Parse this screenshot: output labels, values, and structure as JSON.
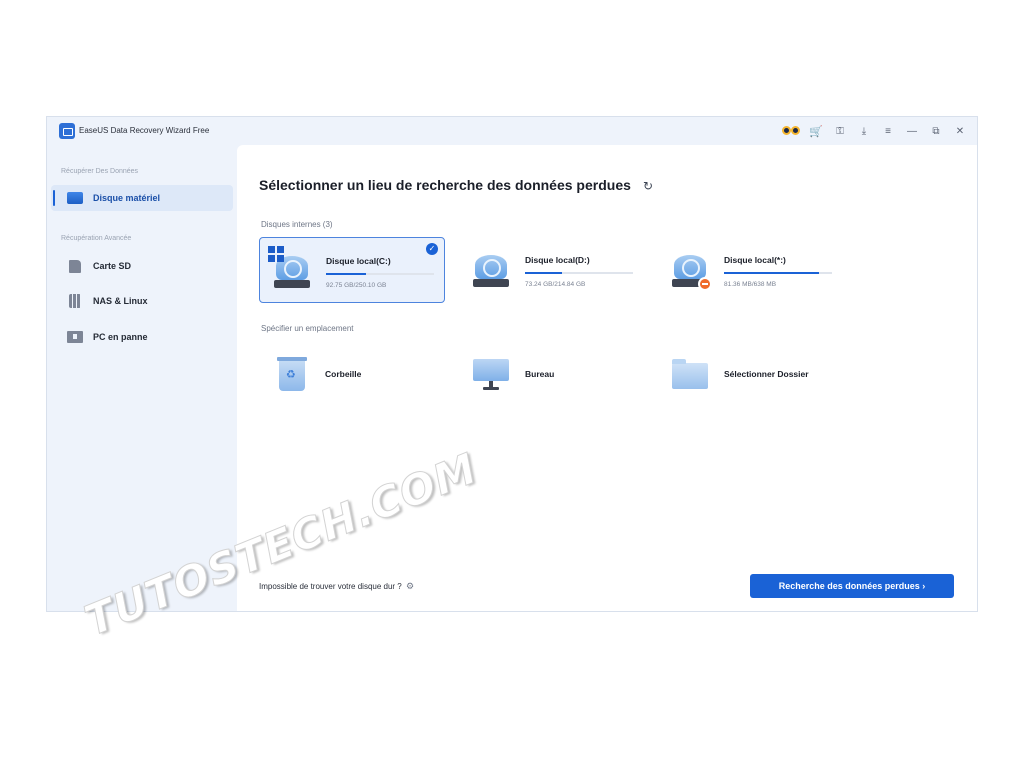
{
  "app": {
    "title": "EaseUS Data Recovery Wizard Free"
  },
  "titlebar": {
    "icons": [
      "owl-icon",
      "cart-icon",
      "key-icon",
      "download-icon",
      "menu-icon",
      "minimize-icon",
      "restore-icon",
      "close-icon"
    ],
    "menu_glyph": "≡",
    "minimize_glyph": "—",
    "restore_glyph": "⧉",
    "close_glyph": "✕",
    "key_glyph": "⚿",
    "download_glyph": "⤓",
    "cart_glyph": "🛒"
  },
  "sidebar": {
    "section1": "Récupérer Des Données",
    "section2": "Récupération Avancée",
    "items": [
      {
        "label": "Disque matériel",
        "active": true,
        "icon": "disk-icon"
      },
      {
        "label": "Carte SD",
        "active": false,
        "icon": "sd-card-icon"
      },
      {
        "label": "NAS & Linux",
        "active": false,
        "icon": "nas-icon"
      },
      {
        "label": "PC en panne",
        "active": false,
        "icon": "pc-icon"
      }
    ]
  },
  "main": {
    "title": "Sélectionner un lieu de recherche des données perdues",
    "refresh_glyph": "↻",
    "internal_label": "Disques internes (3)",
    "drives": [
      {
        "name": "Disque local(C:)",
        "size": "92.75 GB/250.10 GB",
        "used_fraction": 0.37,
        "selected": true,
        "badge": "windows"
      },
      {
        "name": "Disque local(D:)",
        "size": "73.24 GB/214.84 GB",
        "used_fraction": 0.34,
        "selected": false,
        "badge": ""
      },
      {
        "name": "Disque local(*:)",
        "size": "81.36 MB/638 MB",
        "used_fraction": 0.88,
        "selected": false,
        "badge": "warning"
      }
    ],
    "location_label": "Spécifier un emplacement",
    "locations": [
      {
        "name": "Corbeille",
        "icon": "recycle-bin-icon"
      },
      {
        "name": "Bureau",
        "icon": "desktop-icon"
      },
      {
        "name": "Sélectionner Dossier",
        "icon": "folder-icon"
      }
    ],
    "footer_text": "Impossible de trouver votre disque dur ?",
    "gear_glyph": "⚙",
    "check_glyph": "✓",
    "scan_button": "Recherche des données perdues ›"
  },
  "watermark": "TUTOSTECH.COM",
  "colors": {
    "accent": "#1a62d6",
    "sidebar_bg": "#eef3fb",
    "warning": "#f06a2a",
    "owl": "#f5b52e",
    "cart": "#f28c1f"
  }
}
